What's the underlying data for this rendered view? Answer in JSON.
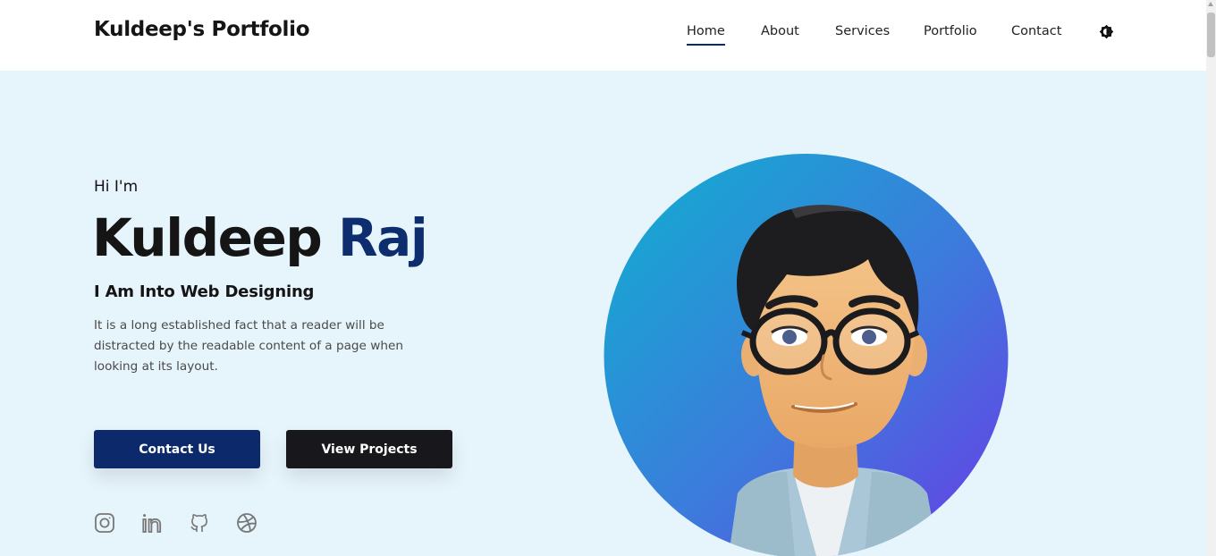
{
  "header": {
    "brand": "Kuldeep's Portfolio",
    "nav": [
      {
        "label": "Home",
        "active": true
      },
      {
        "label": "About",
        "active": false
      },
      {
        "label": "Services",
        "active": false
      },
      {
        "label": "Portfolio",
        "active": false
      },
      {
        "label": "Contact",
        "active": false
      }
    ],
    "theme_icon": "theme-toggle-icon"
  },
  "hero": {
    "greeting": "Hi I'm",
    "first_name": "Kuldeep",
    "last_name": "Raj",
    "tagline": "I Am Into Web Designing",
    "description": "It is a long established fact that a reader will be distracted by the readable content of a page when looking at its layout.",
    "buttons": {
      "contact": "Contact Us",
      "projects": "View Projects"
    },
    "social_icons": [
      "instagram-icon",
      "linkedin-icon",
      "github-icon",
      "dribbble-icon"
    ]
  },
  "colors": {
    "background": "#e6f4fb",
    "accent": "#0c2a6b",
    "dark_button": "#18181c",
    "avatar_gradient_start": "#0fb0d0",
    "avatar_gradient_end": "#6a3be6"
  }
}
